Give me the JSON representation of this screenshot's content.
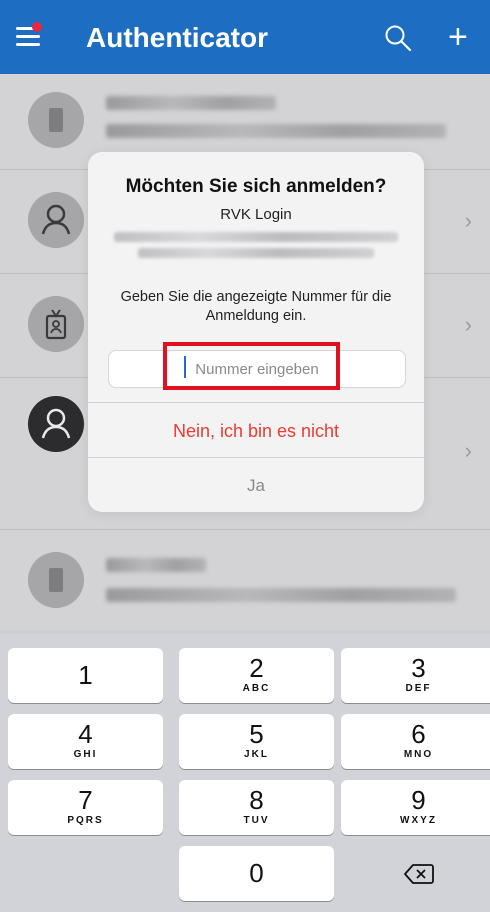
{
  "header": {
    "title": "Authenticator",
    "colors": {
      "bar": "#1d6ec2",
      "badge": "#e8283d"
    },
    "icons": [
      "menu-icon",
      "search-icon",
      "plus-icon"
    ]
  },
  "list": {
    "rows": [
      {
        "icon": "building-icon"
      },
      {
        "icon": "person-icon"
      },
      {
        "icon": "badge-icon"
      },
      {
        "icon": "person-icon"
      },
      {
        "icon": "building-icon"
      }
    ]
  },
  "dialog": {
    "title": "Möchten Sie sich anmelden?",
    "subtitle": "RVK Login",
    "message": "Geben Sie die angezeigte Nummer für die Anmeldung ein.",
    "input_placeholder": "Nummer eingeben",
    "input_value": "",
    "deny_label": "Nein, ich bin es nicht",
    "approve_label": "Ja",
    "colors": {
      "deny": "#ee3b30",
      "highlight": "#e0101f"
    }
  },
  "keypad": {
    "keys": [
      {
        "num": "1",
        "letters": ""
      },
      {
        "num": "2",
        "letters": "ABC"
      },
      {
        "num": "3",
        "letters": "DEF"
      },
      {
        "num": "4",
        "letters": "GHI"
      },
      {
        "num": "5",
        "letters": "JKL"
      },
      {
        "num": "6",
        "letters": "MNO"
      },
      {
        "num": "7",
        "letters": "PQRS"
      },
      {
        "num": "8",
        "letters": "TUV"
      },
      {
        "num": "9",
        "letters": "WXYZ"
      },
      {
        "num": "0",
        "letters": ""
      }
    ],
    "backspace_icon": "backspace-icon"
  }
}
